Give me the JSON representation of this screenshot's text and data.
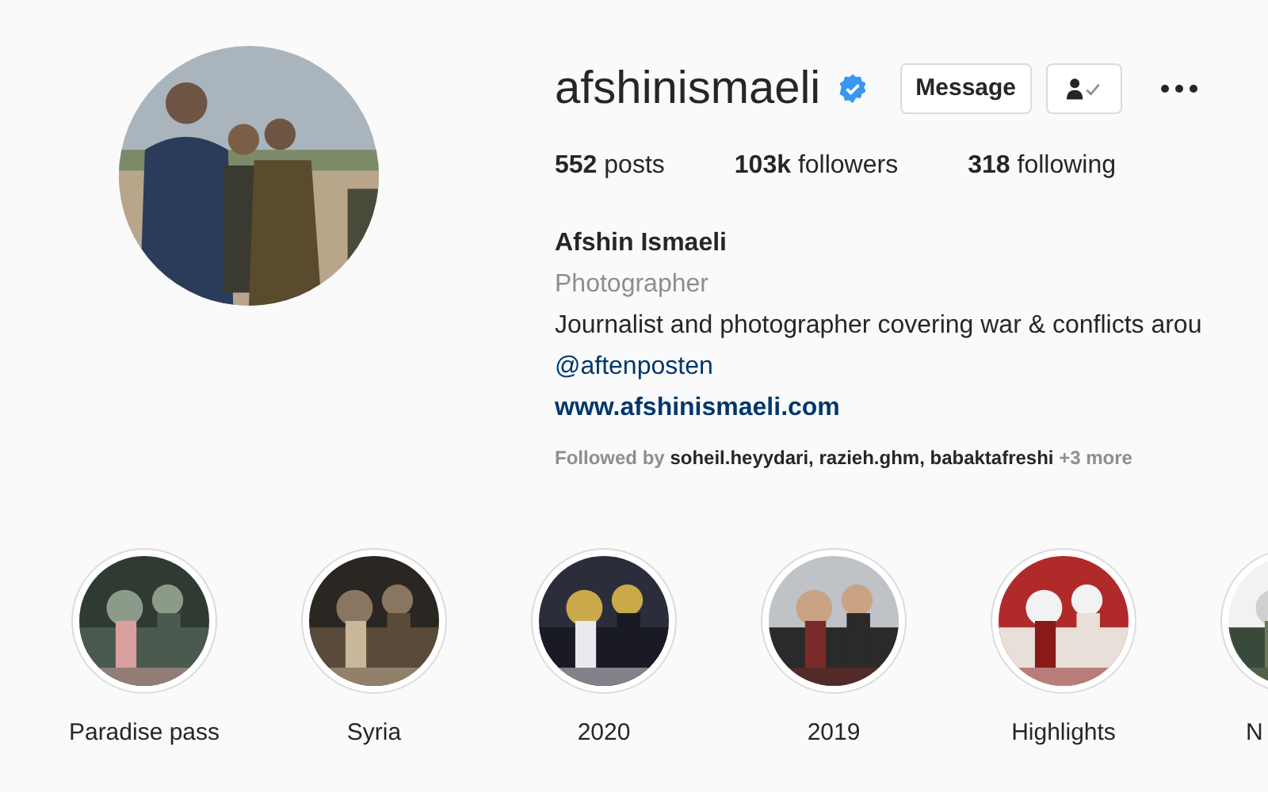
{
  "profile": {
    "username": "afshinismaeli",
    "verified": true,
    "buttons": [
      {
        "kind": "text",
        "label": "Message"
      },
      {
        "kind": "follow-icon"
      },
      {
        "kind": "more-icon"
      }
    ],
    "stats": [
      {
        "count": "552",
        "label": "posts"
      },
      {
        "count": "103k",
        "label": "followers"
      },
      {
        "count": "318",
        "label": "following"
      }
    ],
    "name": "Afshin Ismaeli",
    "category": "Photographer",
    "bio": "Journalist and photographer covering war & conflicts arou",
    "mention": "@aftenposten",
    "website": "www.afshinismaeli.com",
    "followed_by": {
      "prefix": "Followed by",
      "names": "soheil.heyydari, razieh.ghm, babaktafreshi",
      "more": "+3 more"
    }
  },
  "highlights": [
    {
      "label": "Paradise pass",
      "cut_by_edge": false
    },
    {
      "label": "Syria",
      "cut_by_edge": false
    },
    {
      "label": "2020",
      "cut_by_edge": false
    },
    {
      "label": "2019",
      "cut_by_edge": false
    },
    {
      "label": "Highlights",
      "cut_by_edge": false
    },
    {
      "label": "N",
      "cut_by_edge": true
    }
  ]
}
